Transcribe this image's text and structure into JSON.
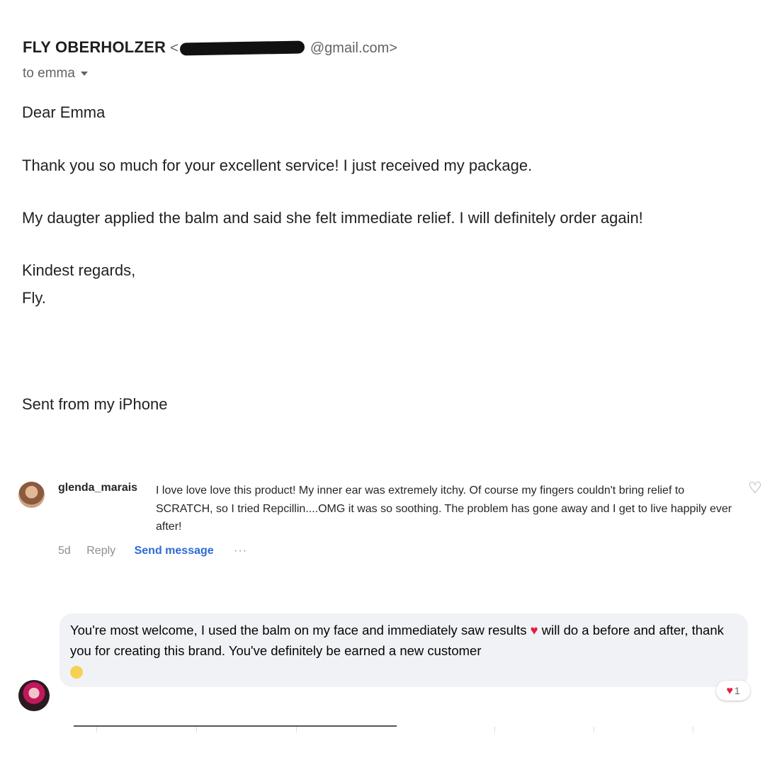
{
  "email": {
    "sender_name": "FLY OBERHOLZER",
    "sender_email_visible": "@gmail.com",
    "recipient": "to emma",
    "greeting": "Dear Emma",
    "para1": "Thank you so much for your excellent service! I just received my package.",
    "para2": "My daugter applied the balm and said she felt immediate relief. I will definitely order again!",
    "signoff": "Kindest regards,",
    "signature": "Fly.",
    "footer": "Sent from my iPhone"
  },
  "comment": {
    "username": "glenda_marais",
    "text": "I love love love this product! My inner ear was extremely itchy. Of course my fingers couldn't bring relief to SCRATCH, so I tried Repcillin....OMG it was so soothing. The problem has gone away and I get to live happily ever after!",
    "age": "5d",
    "reply_label": "Reply",
    "send_message_label": "Send message",
    "more_label": "···"
  },
  "reply": {
    "text_before_heart": "You're most welcome, I used the balm on my face and immediately saw results",
    "text_after_heart": "will do a before and after, thank you for creating this brand. You've definitely be earned a new customer",
    "reaction_count": "1"
  },
  "icons": {
    "caret": "chevron-down-icon",
    "heart_outline": "heart-outline-icon",
    "heart": "heart-icon",
    "smile": "smile-emoji-icon"
  },
  "colors": {
    "link_blue": "#2b6cd4",
    "heart_red": "#e41e3f",
    "bubble_bg": "#f0f2f5"
  }
}
